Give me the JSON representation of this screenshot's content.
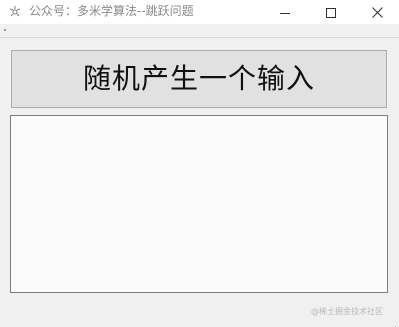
{
  "window": {
    "title": "公众号：多米学算法--跳跃问题",
    "controls": {
      "minimize_icon": "minimize-icon",
      "maximize_icon": "maximize-icon",
      "close_icon": "close-icon"
    }
  },
  "main": {
    "generate_button_label": "随机产生一个输入",
    "output_value": ""
  },
  "footer": {
    "watermark": "@稀土掘金技术社区"
  },
  "colors": {
    "window_background": "#f0f0f0",
    "titlebar_background": "#ffffff",
    "button_background": "#e1e1e1",
    "button_border": "#adadad",
    "textarea_background": "#fbfbfb",
    "textarea_border": "#7a7a7a"
  }
}
